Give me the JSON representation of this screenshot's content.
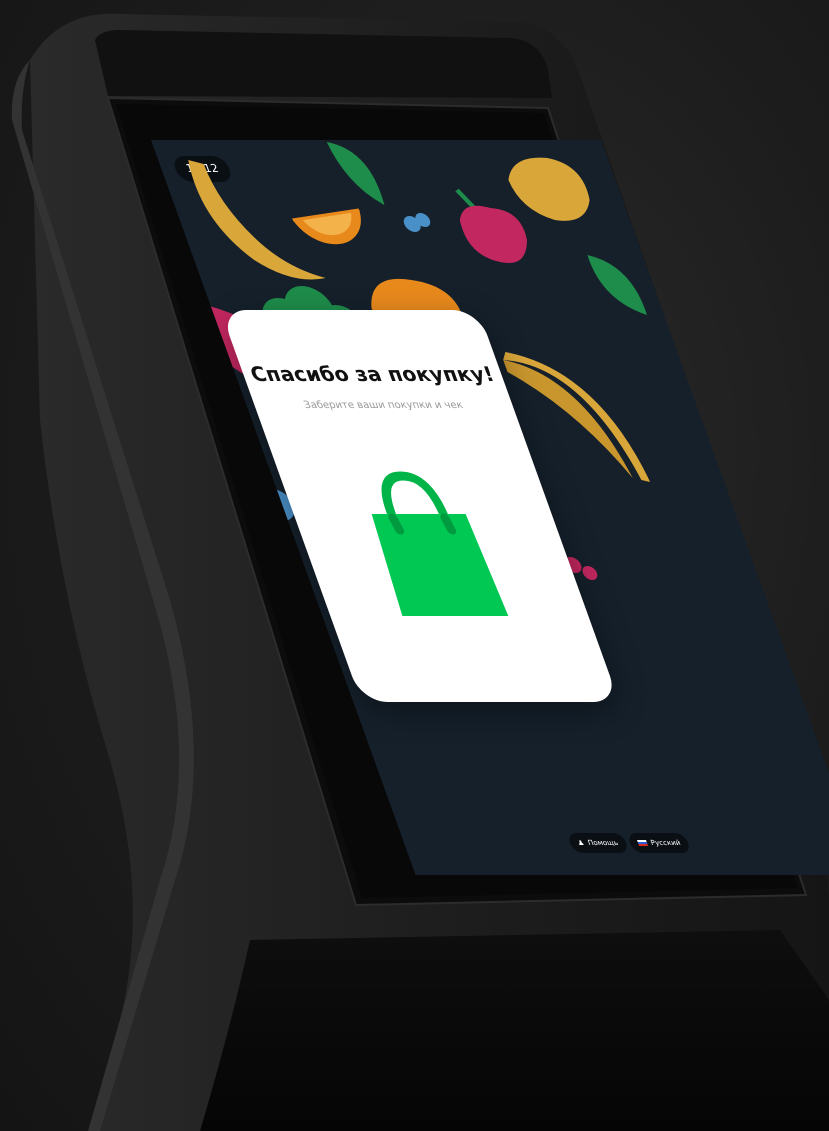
{
  "status_bar": {
    "time": "10:12"
  },
  "dialog": {
    "title": "Спасибо за покупку!",
    "subtitle": "Заберите ваши покупки и чек",
    "icon": "shopping-bag-icon"
  },
  "bottom_bar": {
    "help": {
      "label": "Помощь",
      "icon": "person-icon"
    },
    "language": {
      "label": "Русский",
      "icon": "russia-flag-icon"
    }
  },
  "colors": {
    "screen_background": "#15202b",
    "card_background": "#ffffff",
    "accent_green": "#00c853",
    "kiosk_body": "#1b1b1b"
  }
}
